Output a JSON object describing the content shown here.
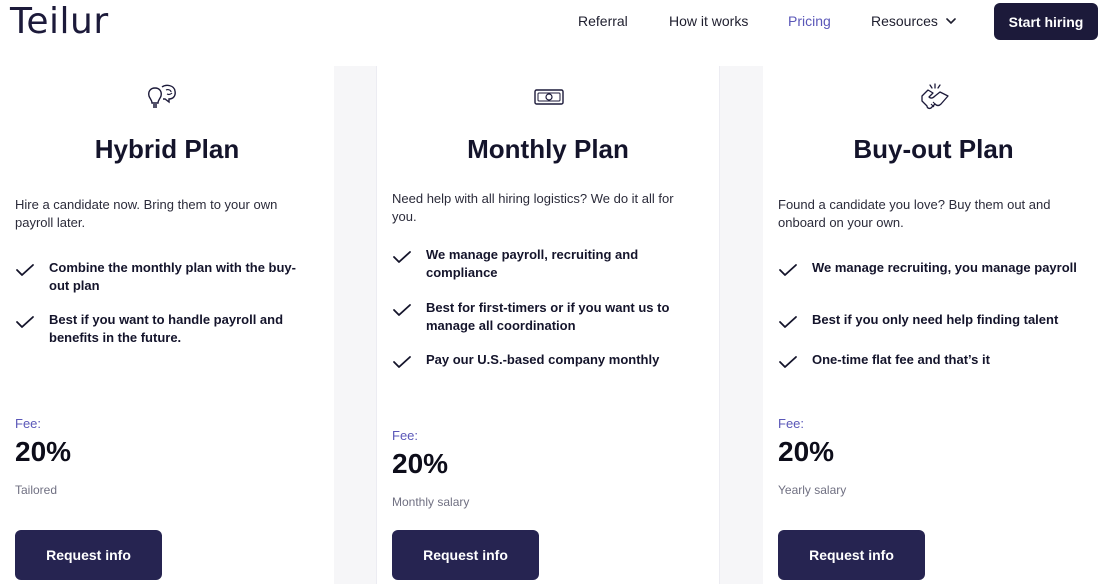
{
  "header": {
    "logo": "Teilur",
    "nav": {
      "referral": "Referral",
      "how_it_works": "How it works",
      "pricing": "Pricing",
      "resources": "Resources"
    },
    "cta": "Start hiring"
  },
  "colors": {
    "brand_dark": "#1c1a3a",
    "accent": "#5a57b8",
    "button": "#262451"
  },
  "plans": [
    {
      "icon": "lightbulb-brain-icon",
      "title": "Hybrid Plan",
      "description": "Hire a candidate now. Bring them to your own payroll later.",
      "features": [
        "Combine the monthly plan with the buy-out plan",
        "Best if you want to handle payroll and benefits in the future."
      ],
      "fee_label": "Fee:",
      "fee_value": "20%",
      "fee_note": "Tailored",
      "button": "Request info"
    },
    {
      "icon": "money-bill-icon",
      "title": "Monthly Plan",
      "description": "Need help with all hiring logistics? We do it all for you.",
      "features": [
        "We manage payroll, recruiting and compliance",
        "Best for first-timers or if you want us to manage all coordination",
        "Pay our U.S.-based company monthly"
      ],
      "fee_label": "Fee:",
      "fee_value": "20%",
      "fee_note": "Monthly salary",
      "button": "Request info"
    },
    {
      "icon": "handshake-icon",
      "title": "Buy-out Plan",
      "description": "Found a candidate you love? Buy them out and onboard on your own.",
      "features": [
        "We manage recruiting, you manage payroll",
        "Best if you only need help finding talent",
        "One-time flat fee and that’s it"
      ],
      "fee_label": "Fee:",
      "fee_value": "20%",
      "fee_note": "Yearly salary",
      "button": "Request info"
    }
  ]
}
